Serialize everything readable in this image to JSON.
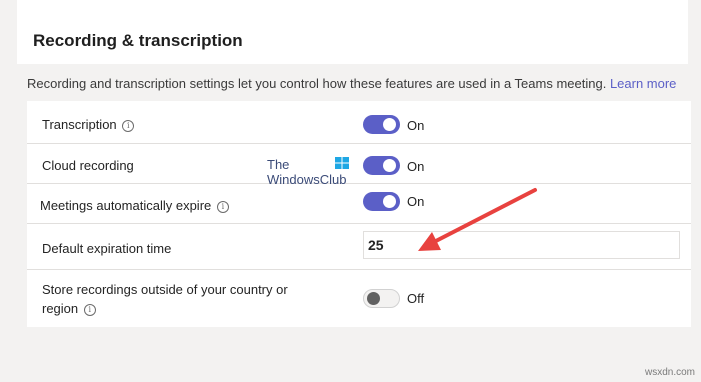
{
  "section": {
    "title": "Recording & transcription",
    "description": "Recording and transcription settings let you control how these features are used in a Teams meeting.",
    "learn_more": "Learn more"
  },
  "settings": [
    {
      "label": "Transcription",
      "info": true,
      "state": "On"
    },
    {
      "label": "Cloud recording",
      "info": false,
      "state": "On"
    },
    {
      "label": "Meetings automatically expire",
      "info": true,
      "state": "On"
    },
    {
      "label": "Default expiration time",
      "value": "25"
    },
    {
      "label": "Store recordings outside of your country or region",
      "label_line1": "Store recordings outside of your country or",
      "label_line2": "region",
      "info": true,
      "state": "Off"
    }
  ],
  "watermark": {
    "line1": "The",
    "line2": "WindowsClub"
  },
  "site_watermark": "wsxdn.com",
  "colors": {
    "accent": "#5b5fc7",
    "arrow": "#e8423f",
    "background": "#f3f2f1"
  },
  "icons": {
    "info": "info-circle-icon",
    "arrow": "red-annotation-arrow"
  }
}
